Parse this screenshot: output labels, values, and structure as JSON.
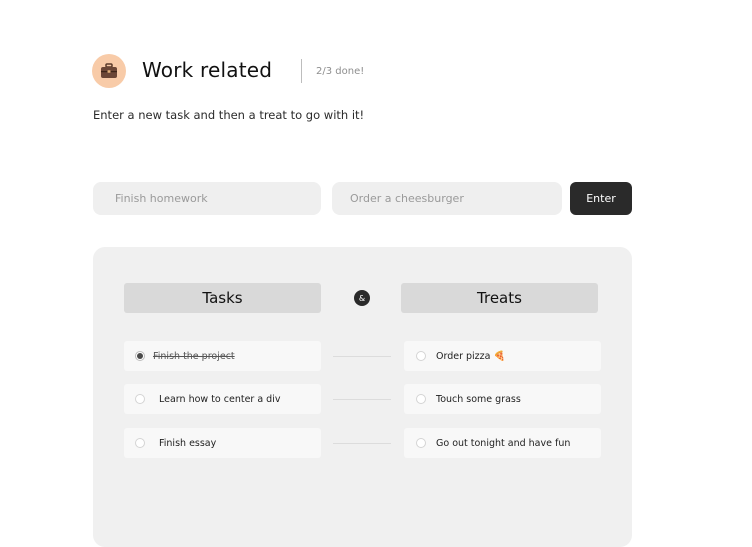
{
  "header": {
    "icon": "briefcase-icon",
    "title": "Work related",
    "progress": "2/3 done!",
    "subtitle": "Enter a new task and then a treat to go with it!"
  },
  "form": {
    "task_placeholder": "Finish homework",
    "treat_placeholder": "Order a cheesburger",
    "enter_label": "Enter"
  },
  "board": {
    "tasks_heading": "Tasks",
    "ampersand": "&",
    "treats_heading": "Treats",
    "tasks": [
      {
        "label": "Finish the project",
        "done": true
      },
      {
        "label": "Learn how to center a div",
        "done": false
      },
      {
        "label": "Finish essay",
        "done": false
      }
    ],
    "treats": [
      {
        "label": "Order pizza 🍕",
        "done": false
      },
      {
        "label": "Touch some grass",
        "done": false
      },
      {
        "label": "Go out tonight and have fun",
        "done": false
      }
    ]
  },
  "colors": {
    "accent_dark": "#2a2a2a",
    "avatar_bg": "#f8cba8",
    "board_bg": "#f0f0f0",
    "heading_bg": "#d9d9d9"
  }
}
